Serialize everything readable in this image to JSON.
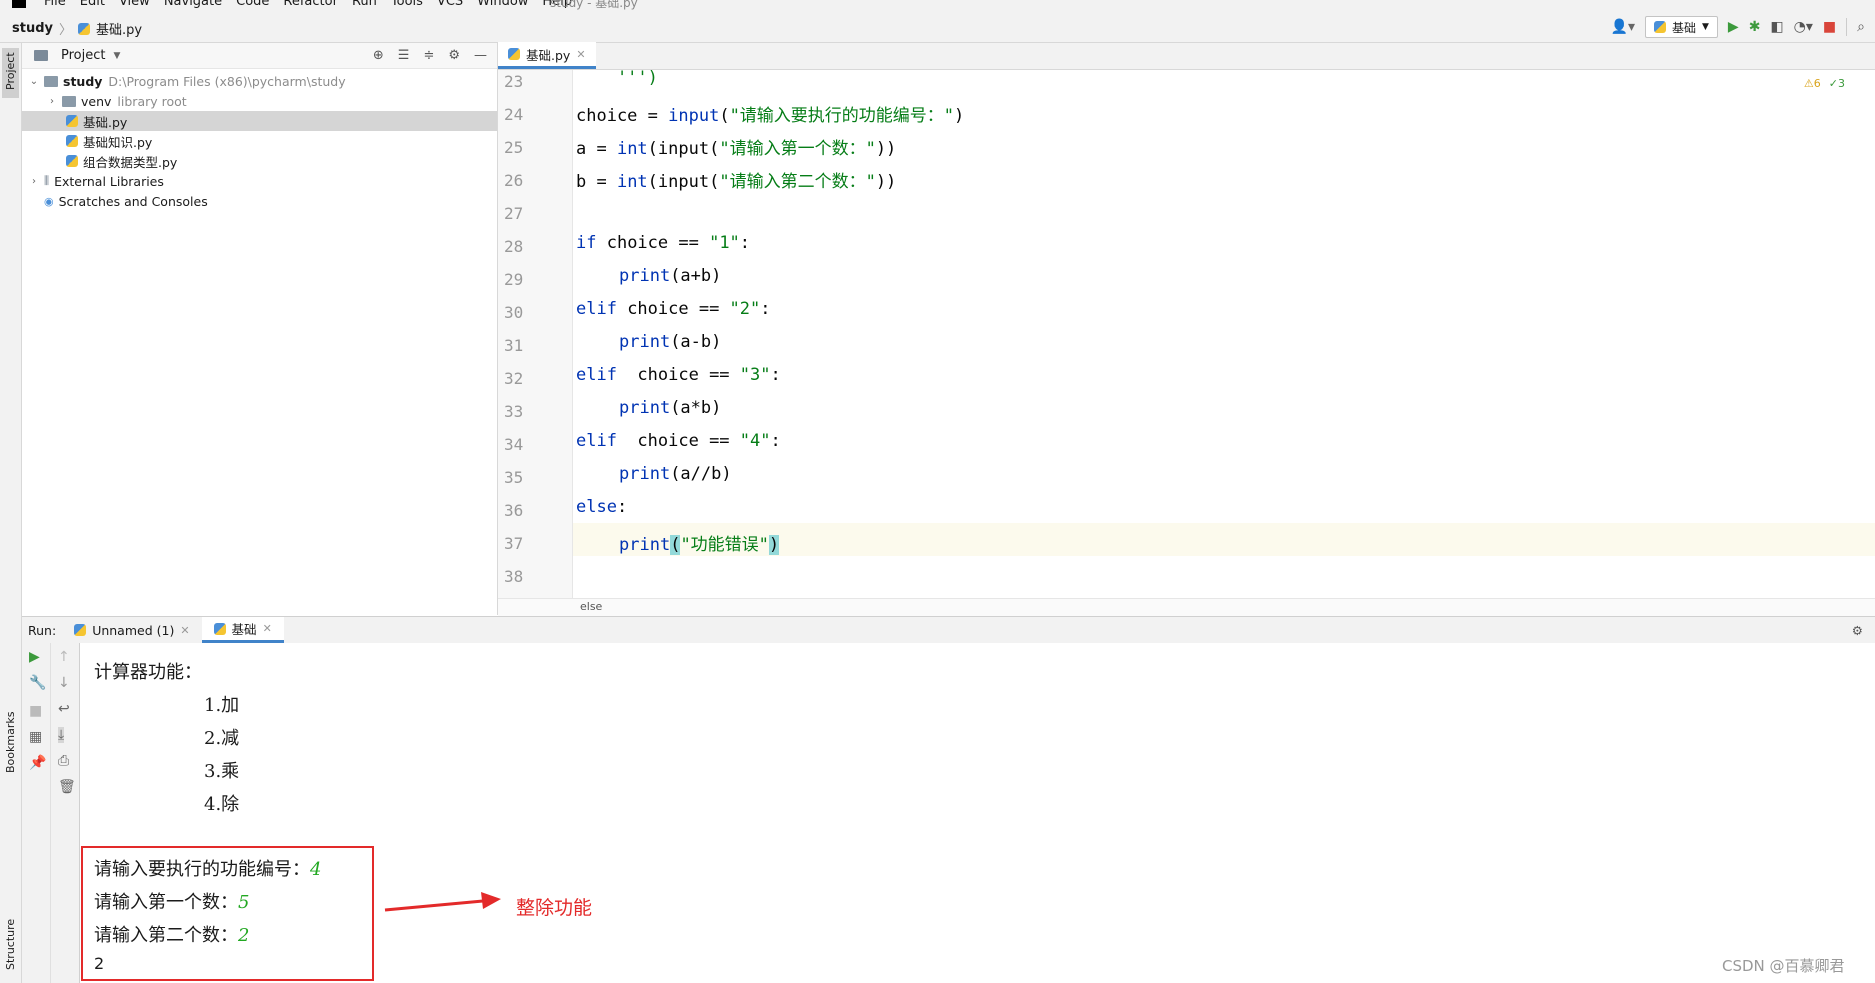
{
  "menubar": {
    "items": [
      "File",
      "Edit",
      "View",
      "Navigate",
      "Code",
      "Refactor",
      "Run",
      "Tools",
      "VCS",
      "Window",
      "Help"
    ],
    "window_title": "study - 基础.py"
  },
  "navbar": {
    "project": "study",
    "file": "基础.py",
    "run_config": "基础"
  },
  "left_stripe": {
    "project": "Project",
    "bookmarks": "Bookmarks",
    "structure": "Structure"
  },
  "project_panel": {
    "title": "Project",
    "tree": [
      {
        "label": "study",
        "hint": "D:\\Program Files (x86)\\pycharm\\study"
      },
      {
        "label": "venv",
        "hint": "library root"
      },
      {
        "label": "基础.py"
      },
      {
        "label": "基础知识.py"
      },
      {
        "label": "组合数据类型.py"
      },
      {
        "label": "External Libraries"
      },
      {
        "label": "Scratches and Consoles"
      }
    ]
  },
  "editor": {
    "tab": "基础.py",
    "inspections": {
      "warnings": "6",
      "ok": "3"
    },
    "line_numbers": [
      "23",
      "24",
      "25",
      "26",
      "27",
      "28",
      "29",
      "30",
      "31",
      "32",
      "33",
      "34",
      "35",
      "36",
      "37",
      "38"
    ],
    "footer": "else",
    "code": {
      "l23": "    ''')",
      "l24": {
        "a": "choice = ",
        "b": "input",
        "c": "(",
        "d": "\"请输入要执行的功能编号：\"",
        "e": ")"
      },
      "l25": {
        "a": "a = ",
        "b": "int",
        "c": "(input(",
        "d": "\"请输入第一个数：\"",
        "e": "))"
      },
      "l26": {
        "a": "b = ",
        "b": "int",
        "c": "(input(",
        "d": "\"请输入第二个数：\"",
        "e": "))"
      },
      "l28": {
        "a": "if",
        "b": " choice == ",
        "c": "\"1\"",
        "d": ":"
      },
      "l29": {
        "a": "print",
        "b": "(a+b)"
      },
      "l30": {
        "a": "elif",
        "b": " choice == ",
        "c": "\"2\"",
        "d": ":"
      },
      "l31": {
        "a": "print",
        "b": "(a-b)"
      },
      "l32": {
        "a": "elif",
        "b": "  choice == ",
        "c": "\"3\"",
        "d": ":"
      },
      "l33": {
        "a": "print",
        "b": "(a*b)"
      },
      "l34": {
        "a": "elif",
        "b": "  choice == ",
        "c": "\"4\"",
        "d": ":"
      },
      "l35": {
        "a": "print",
        "b": "(a//b)"
      },
      "l36": {
        "a": "else",
        "b": ":"
      },
      "l37": {
        "a": "print",
        "b": "(",
        "c": "\"功能错误\"",
        "d": ")"
      }
    }
  },
  "run": {
    "label": "Run:",
    "tabs": [
      "Unnamed (1)",
      "基础"
    ]
  },
  "console": {
    "lines": [
      "计算器功能：",
      "1.加",
      "2.减",
      "3.乘",
      "4.除"
    ],
    "prompts": [
      {
        "text": "请输入要执行的功能编号：",
        "input": "4"
      },
      {
        "text": "请输入第一个数：",
        "input": "5"
      },
      {
        "text": "请输入第二个数：",
        "input": "2"
      }
    ],
    "result": "2"
  },
  "annotation": {
    "text": "整除功能",
    "color": "#e32a2a"
  },
  "watermark": "CSDN @百慕卿君"
}
